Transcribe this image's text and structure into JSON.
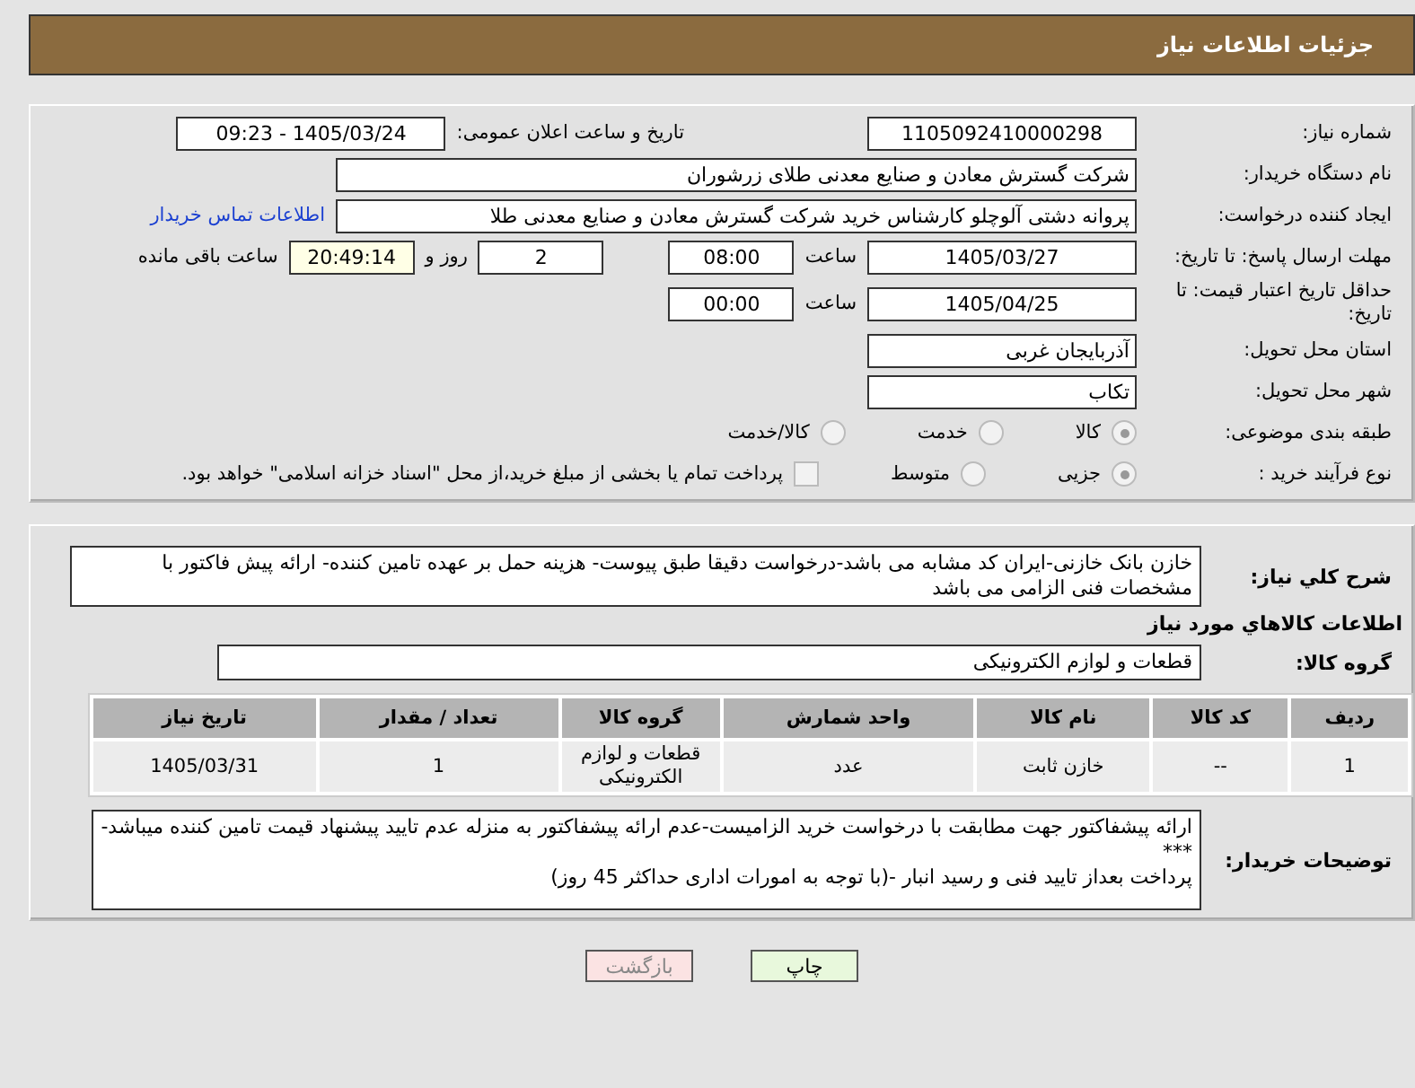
{
  "title": "جزئیات اطلاعات نیاز",
  "need_number": {
    "label": "شماره نیاز:",
    "value": "1105092410000298"
  },
  "announce": {
    "label": "تاریخ و ساعت اعلان عمومی:",
    "value": "1405/03/24 - 09:23"
  },
  "buyer": {
    "label": "نام دستگاه خریدار:",
    "value": "شرکت گسترش معادن و صنایع معدنی طلای زرشوران"
  },
  "creator": {
    "label": "ایجاد کننده درخواست:",
    "value": "پروانه  دشتی آلوچلو کارشناس خرید شرکت گسترش معادن و صنایع معدنی طلا",
    "link": "اطلاعات تماس خریدار"
  },
  "deadline": {
    "label": "مهلت ارسال پاسخ: تا تاریخ:",
    "date": "1405/03/27",
    "time_label": "ساعت",
    "time": "08:00",
    "days": "2",
    "days_label": "روز و",
    "remaining": "20:49:14",
    "remaining_label": "ساعت باقی مانده"
  },
  "validity": {
    "label": "حداقل تاریخ اعتبار قیمت: تا تاریخ:",
    "date": "1405/04/25",
    "time_label": "ساعت",
    "time": "00:00"
  },
  "province": {
    "label": "استان محل تحویل:",
    "value": "آذربایجان غربی"
  },
  "city": {
    "label": "شهر محل تحویل:",
    "value": "تکاب"
  },
  "category": {
    "label": "طبقه بندی موضوعی:",
    "options": [
      {
        "label": "کالا",
        "selected": true
      },
      {
        "label": "خدمت",
        "selected": false
      },
      {
        "label": "کالا/خدمت",
        "selected": false
      }
    ]
  },
  "process": {
    "label": "نوع فرآیند خرید :",
    "options": [
      {
        "label": "جزیی",
        "selected": true
      },
      {
        "label": "متوسط",
        "selected": false
      }
    ],
    "payment": {
      "label": "پرداخت تمام یا بخشی از مبلغ خرید،از محل \"اسناد خزانه اسلامی\" خواهد بود.",
      "checked": false
    }
  },
  "description": {
    "label": "شرح کلي نياز:",
    "value": "خازن بانک خازنی-ایران کد مشابه می باشد-درخواست دقیقا طبق پیوست- هزینه حمل بر عهده تامین کننده- ارائه پیش فاکتور با مشخصات فنی الزامی می باشد"
  },
  "goods_heading": "اطلاعات کالاهاي مورد نياز",
  "goods_group": {
    "label": "گروه کالا:",
    "value": "قطعات و لوازم الکترونیکی"
  },
  "table": {
    "columns": [
      "ردیف",
      "کد کالا",
      "نام کالا",
      "واحد شمارش",
      "گروه کالا",
      "تعداد / مقدار",
      "تاریخ نیاز"
    ],
    "rows": [
      [
        "1",
        "--",
        "خازن ثابت",
        "عدد",
        "قطعات و لوازم الکترونیکی",
        "1",
        "1405/03/31"
      ]
    ]
  },
  "buyer_notes": {
    "label": "توضیحات خریدار:",
    "value": "ارائه پیشفاکتور جهت مطابقت با درخواست خرید الزامیست-عدم ارائه پیشفاکتور به منزله عدم تایید پیشنهاد قیمت تامین کننده میباشد-***\nپرداخت بعداز تایید فنی و رسید انبار -(با توجه به امورات اداری حداکثر 45 روز)"
  },
  "buttons": [
    {
      "label": "چاپ",
      "kind": "print"
    },
    {
      "label": "بازگشت",
      "kind": "back"
    }
  ]
}
